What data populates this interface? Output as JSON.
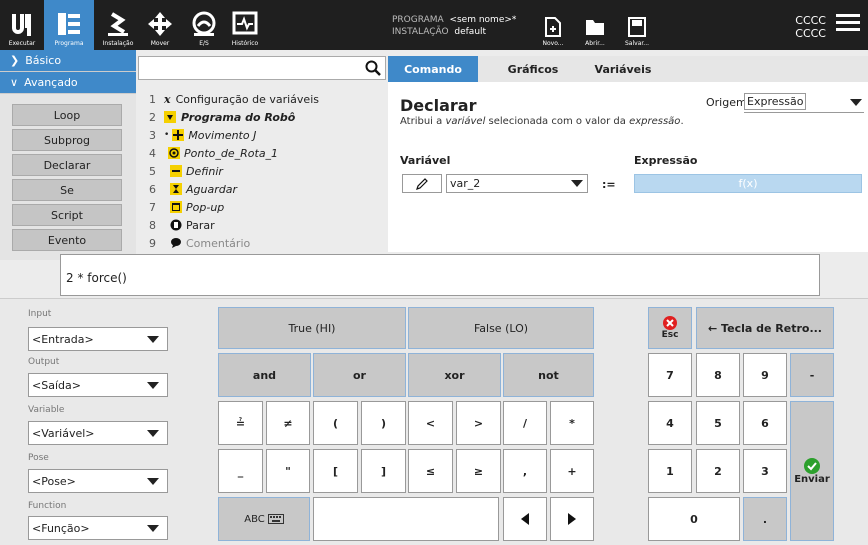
{
  "topbar": {
    "tabs": [
      {
        "label": "Executar",
        "icon": "ur-logo-icon"
      },
      {
        "label": "Programa",
        "icon": "program-icon"
      },
      {
        "label": "Instalação",
        "icon": "installation-icon"
      },
      {
        "label": "Mover",
        "icon": "move-icon"
      },
      {
        "label": "E/S",
        "icon": "io-icon"
      },
      {
        "label": "Histórico",
        "icon": "log-icon"
      }
    ],
    "program_label": "PROGRAMA",
    "program_value": "<sem nome>*",
    "install_label": "INSTALAÇÃO",
    "install_value": "default",
    "file_buttons": [
      {
        "label": "Novo...",
        "icon": "new-file-icon"
      },
      {
        "label": "Abrir...",
        "icon": "folder-icon"
      },
      {
        "label": "Salvar...",
        "icon": "save-icon"
      }
    ],
    "right_line1": "CCCC",
    "right_line2": "CCCC"
  },
  "leftnav": {
    "basic": "Básico",
    "advanced": "Avançado",
    "items": [
      "Loop",
      "Subprog",
      "Declarar",
      "Se",
      "Script",
      "Evento"
    ]
  },
  "search": {
    "placeholder": ""
  },
  "tree": [
    {
      "n": "1",
      "text": "Configuração de variáveis",
      "icon": "x"
    },
    {
      "n": "2",
      "text": "Programa do Robô",
      "icon": "prog"
    },
    {
      "n": "3",
      "text": "Movimento J",
      "icon": "move"
    },
    {
      "n": "4",
      "text": "Ponto_de_Rota_1",
      "icon": "wp"
    },
    {
      "n": "5",
      "text": "Definir",
      "icon": "set"
    },
    {
      "n": "6",
      "text": "Aguardar",
      "icon": "wait"
    },
    {
      "n": "7",
      "text": "Pop-up",
      "icon": "popup"
    },
    {
      "n": "8",
      "text": "Parar",
      "icon": "stop"
    },
    {
      "n": "9",
      "text": "Comentário",
      "icon": "comment"
    }
  ],
  "tabs": [
    "Comando",
    "Gráficos",
    "Variáveis"
  ],
  "panel": {
    "title": "Declarar",
    "desc_prefix": "Atribui a ",
    "desc_var": "variável",
    "desc_mid": " selecionada com o valor da ",
    "desc_expr": "expressão",
    "desc_suffix": ".",
    "origin_label": "Origem",
    "origin_value": "Expressão",
    "var_label": "Variável",
    "var_value": "var_2",
    "assign": ":=",
    "expr_label": "Expressão",
    "expr_value": "f(x)"
  },
  "expression": "2 * force()",
  "selectors": [
    {
      "label": "Input",
      "value": "<Entrada>"
    },
    {
      "label": "Output",
      "value": "<Saída>"
    },
    {
      "label": "Variable",
      "value": "<Variável>"
    },
    {
      "label": "Pose",
      "value": "<Pose>"
    },
    {
      "label": "Function",
      "value": "<Função>"
    }
  ],
  "keys": {
    "true": "True (HI)",
    "false": "False (LO)",
    "logic": [
      "and",
      "or",
      "xor",
      "not"
    ],
    "row3": [
      "≟",
      "≠",
      "(",
      ")",
      "<",
      ">",
      "/",
      "*"
    ],
    "row4": [
      "_",
      "\"",
      "[",
      "]",
      "≤",
      "≥",
      ",",
      "+"
    ],
    "abc": "ABC",
    "esc": "Esc",
    "backspace": "← Tecla de Retro...",
    "nums": [
      "7",
      "8",
      "9",
      "-",
      "4",
      "5",
      "6",
      "1",
      "2",
      "3"
    ],
    "zero": "0",
    "dot": ".",
    "enter": "Enviar"
  }
}
